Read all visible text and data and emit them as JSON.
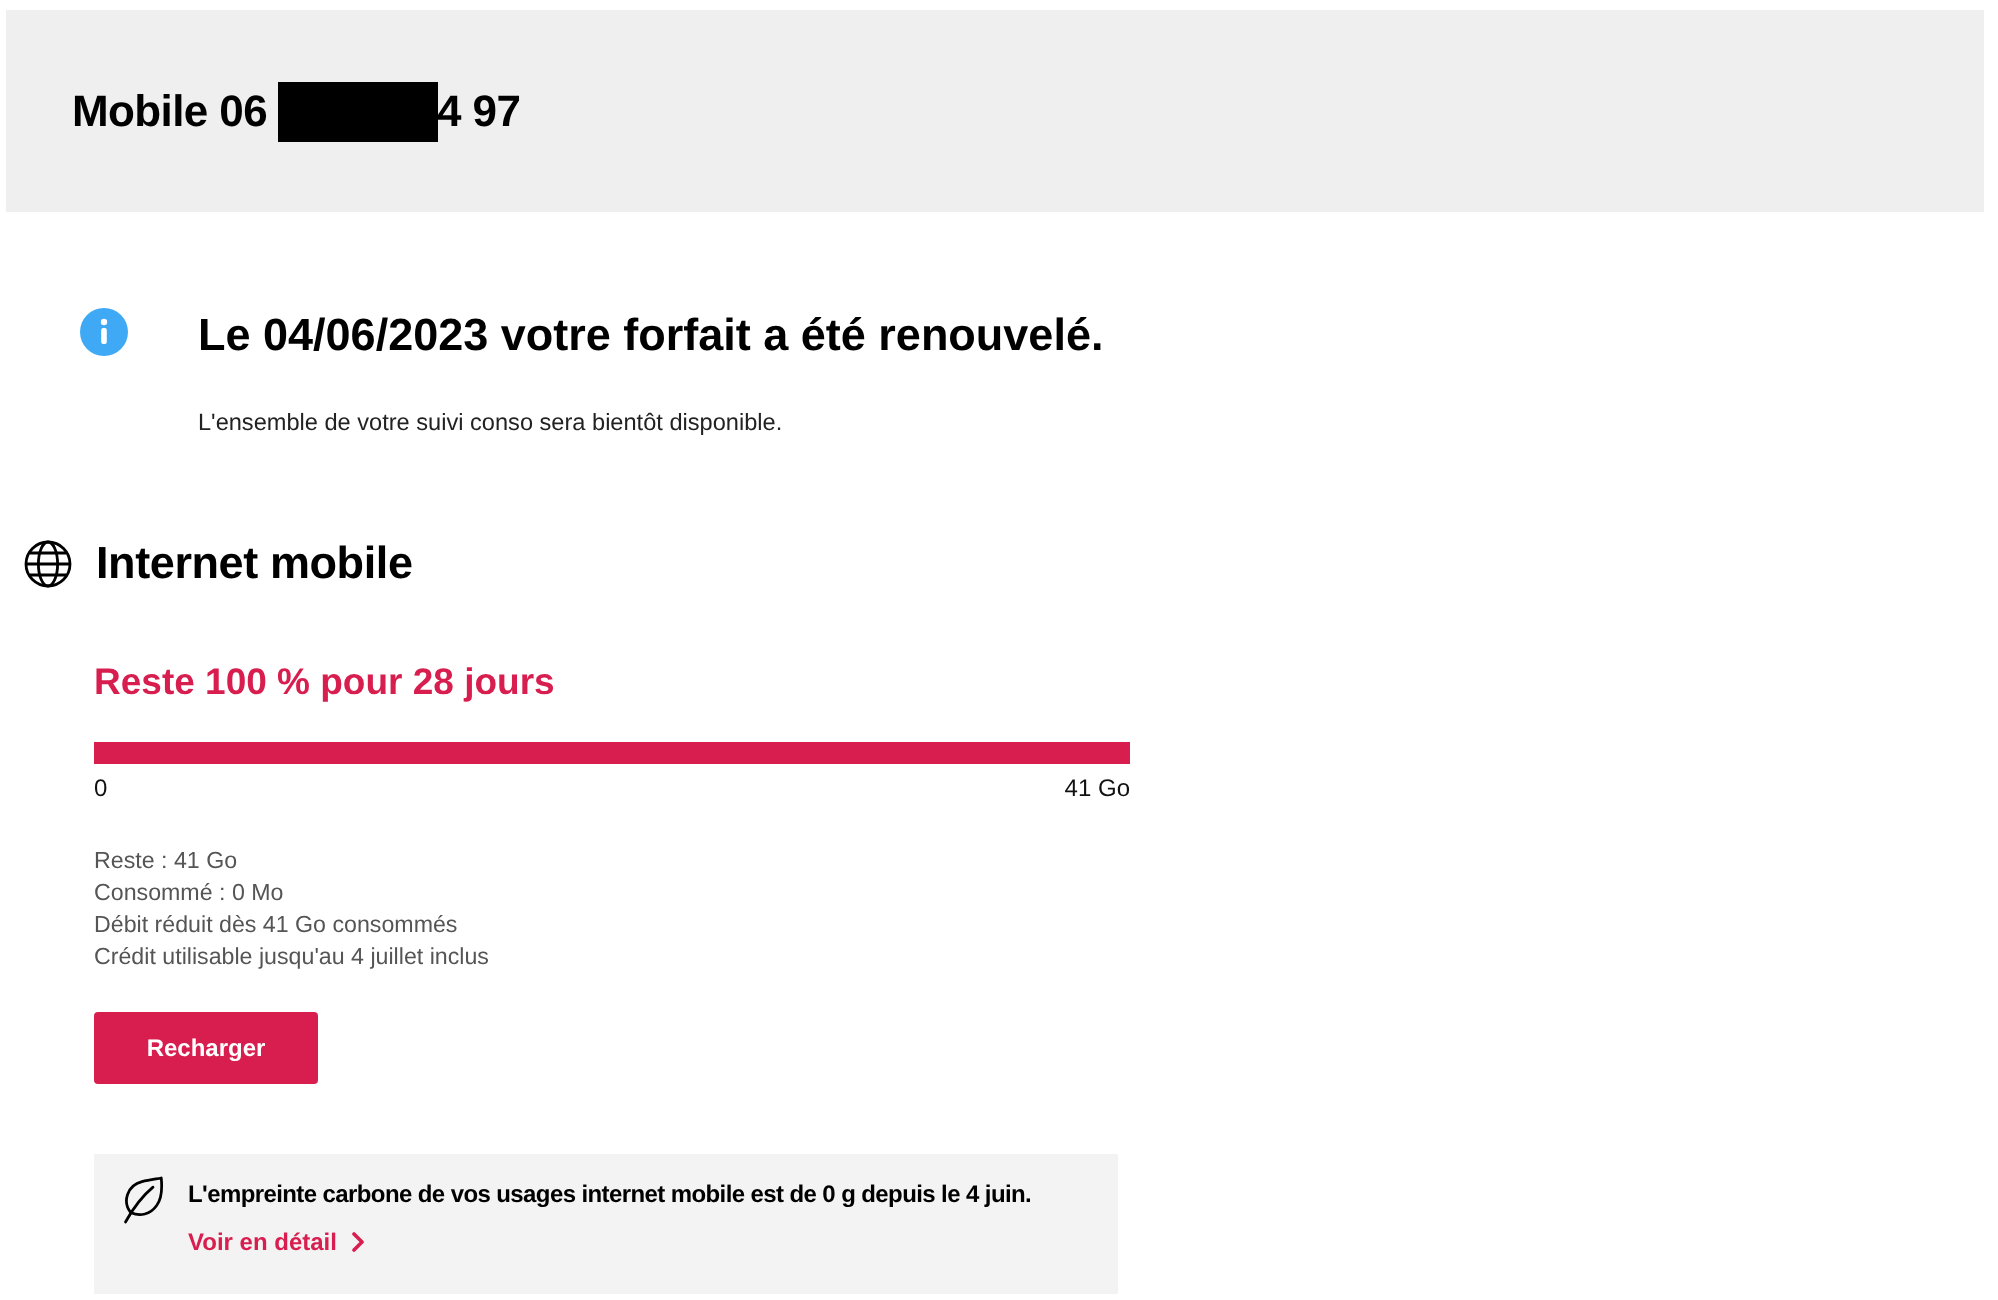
{
  "header": {
    "title_start": "Mobile 06",
    "redacted": true,
    "title_end": "4 97"
  },
  "notice": {
    "title": "Le 04/06/2023 votre forfait a été renouvelé.",
    "text": "L'ensemble de votre suivi conso sera bientôt disponible."
  },
  "internet": {
    "title": "Internet mobile",
    "summary": "Reste 100 % pour 28 jours",
    "gauge": {
      "level": 1,
      "min_label": "0",
      "max_label": "41 Go"
    },
    "details": [
      "Reste : 41 Go",
      "Consommé : 0 Mo",
      "Débit réduit dès 41 Go consommés",
      "Crédit utilisable jusqu'au 4 juillet inclus"
    ],
    "button": "Recharger"
  },
  "carbon": {
    "text": "L'empreinte carbone de vos usages internet mobile est de 0 g depuis le 4 juin.",
    "link": "Voir en détail"
  }
}
